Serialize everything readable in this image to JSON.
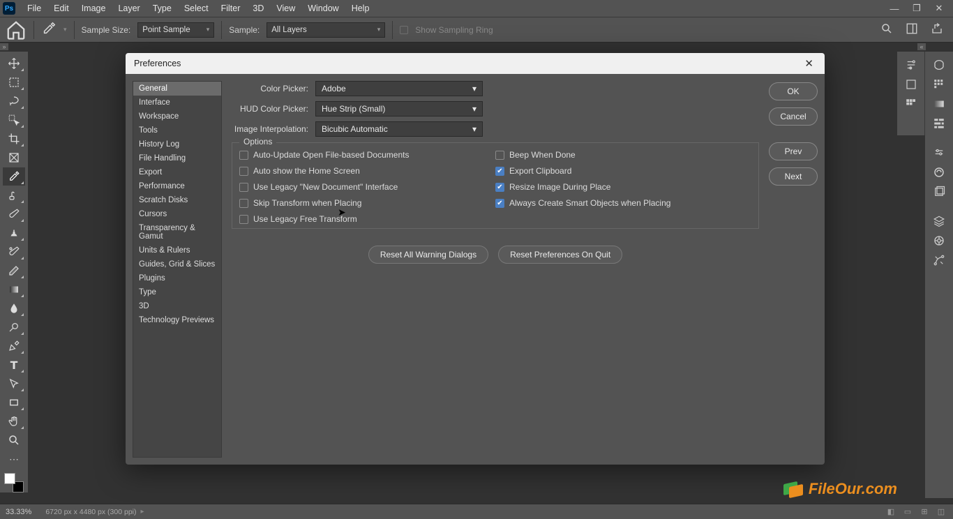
{
  "menubar": [
    "File",
    "Edit",
    "Image",
    "Layer",
    "Type",
    "Select",
    "Filter",
    "3D",
    "View",
    "Window",
    "Help"
  ],
  "optionsbar": {
    "sample_size_label": "Sample Size:",
    "sample_size_value": "Point Sample",
    "sample_label": "Sample:",
    "sample_value": "All Layers",
    "show_sampling": "Show Sampling Ring"
  },
  "dialog": {
    "title": "Preferences",
    "categories": [
      "General",
      "Interface",
      "Workspace",
      "Tools",
      "History Log",
      "File Handling",
      "Export",
      "Performance",
      "Scratch Disks",
      "Cursors",
      "Transparency & Gamut",
      "Units & Rulers",
      "Guides, Grid & Slices",
      "Plugins",
      "Type",
      "3D",
      "Technology Previews"
    ],
    "selected_category": "General",
    "fields": {
      "color_picker": {
        "label": "Color Picker:",
        "value": "Adobe"
      },
      "hud": {
        "label": "HUD Color Picker:",
        "value": "Hue Strip (Small)"
      },
      "interp": {
        "label": "Image Interpolation:",
        "value": "Bicubic Automatic"
      }
    },
    "options_legend": "Options",
    "checks": {
      "auto_update": {
        "label": "Auto-Update Open File-based Documents",
        "checked": false
      },
      "beep": {
        "label": "Beep When Done",
        "checked": false
      },
      "auto_home": {
        "label": "Auto show the Home Screen",
        "checked": false
      },
      "export_clip": {
        "label": "Export Clipboard",
        "checked": true
      },
      "legacy_new": {
        "label": "Use Legacy \"New Document\" Interface",
        "checked": false
      },
      "resize_place": {
        "label": "Resize Image During Place",
        "checked": true
      },
      "skip_transform": {
        "label": "Skip Transform when Placing",
        "checked": false
      },
      "smart_obj": {
        "label": "Always Create Smart Objects when Placing",
        "checked": true
      },
      "legacy_free": {
        "label": "Use Legacy Free Transform",
        "checked": false
      }
    },
    "reset_warnings": "Reset All Warning Dialogs",
    "reset_quit": "Reset Preferences On Quit",
    "buttons": {
      "ok": "OK",
      "cancel": "Cancel",
      "prev": "Prev",
      "next": "Next"
    }
  },
  "status": {
    "zoom": "33.33%",
    "info": "6720 px x 4480 px (300 ppi)"
  },
  "watermark": "FileOur.com"
}
